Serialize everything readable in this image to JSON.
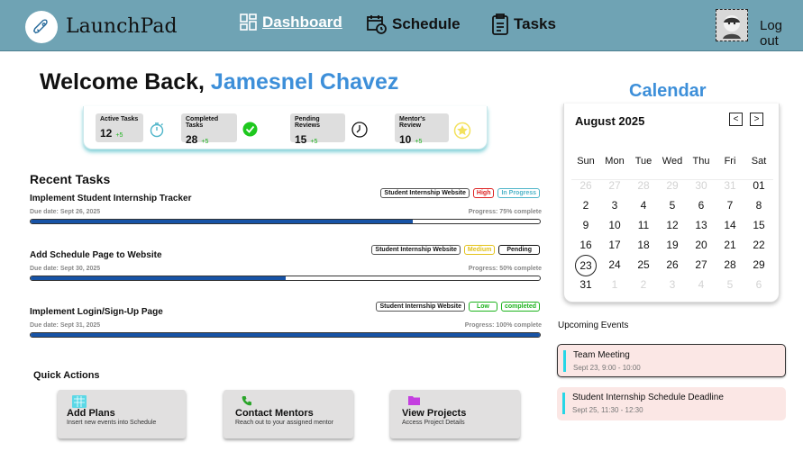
{
  "header": {
    "brand": "LaunchPad",
    "nav": [
      {
        "label": "Dashboard",
        "icon": "dashboard-grid-icon"
      },
      {
        "label": "Schedule",
        "icon": "calendar-clock-icon"
      },
      {
        "label": "Tasks",
        "icon": "clipboard-icon"
      }
    ],
    "logout": "Log out"
  },
  "welcome": {
    "greeting": "Welcome Back,",
    "name": "Jamesnel Chavez"
  },
  "stats": [
    {
      "title": "Active Tasks",
      "value": "12",
      "delta": "+5",
      "icon": "timer-icon"
    },
    {
      "title": "Completed Tasks",
      "value": "28",
      "delta": "+5",
      "icon": "check-circle-icon"
    },
    {
      "title": "Pending Reviews",
      "value": "15",
      "delta": "+5",
      "icon": "clock-icon"
    },
    {
      "title": "Mentor's Review",
      "value": "10",
      "delta": "+5",
      "icon": "star-badge-icon"
    }
  ],
  "recent_tasks": {
    "title": "Recent Tasks",
    "items": [
      {
        "title": "Implement  Student Internship Tracker",
        "due": "Due date: Sept 26, 2025",
        "progress_text": "Progress: 75% complete",
        "progress": 0.75,
        "project": "Student Internship Website",
        "priority": "High",
        "status": "In Progress"
      },
      {
        "title": "Add Schedule Page to Website",
        "due": "Due date: Sept 30, 2025",
        "progress_text": "Progress: 50% complete",
        "progress": 0.5,
        "project": "Student Internship Website",
        "priority": "Medium",
        "status": "Pending"
      },
      {
        "title": "Implement  Login/Sign-Up Page",
        "due": "Due date: Sept 31, 2025",
        "progress_text": "Progress: 100% complete",
        "progress": 1.0,
        "project": "Student Internship Website",
        "priority": "Low",
        "status": "completed"
      }
    ]
  },
  "quick_actions": {
    "title": "Quick Actions",
    "items": [
      {
        "title": "Add Plans",
        "desc": "Insert new events into Schedule",
        "icon": "planner-icon"
      },
      {
        "title": "Contact Mentors",
        "desc": "Reach out to your assigned mentor",
        "icon": "phone-icon"
      },
      {
        "title": "View Projects",
        "desc": "Access Project Details",
        "icon": "folder-icon"
      }
    ]
  },
  "calendar": {
    "title": "Calendar",
    "month": "August 2025",
    "prev": "<",
    "next": ">",
    "day_names": [
      "Sun",
      "Mon",
      "Tue",
      "Wed",
      "Thu",
      "Fri",
      "Sat"
    ],
    "days": [
      {
        "d": "26",
        "m": true
      },
      {
        "d": "27",
        "m": true
      },
      {
        "d": "28",
        "m": true
      },
      {
        "d": "29",
        "m": true
      },
      {
        "d": "30",
        "m": true
      },
      {
        "d": "31",
        "m": true
      },
      {
        "d": "01"
      },
      {
        "d": "2"
      },
      {
        "d": "3"
      },
      {
        "d": "4"
      },
      {
        "d": "5"
      },
      {
        "d": "6"
      },
      {
        "d": "7"
      },
      {
        "d": "8"
      },
      {
        "d": "9"
      },
      {
        "d": "10"
      },
      {
        "d": "11"
      },
      {
        "d": "12"
      },
      {
        "d": "13"
      },
      {
        "d": "14"
      },
      {
        "d": "15"
      },
      {
        "d": "16"
      },
      {
        "d": "17"
      },
      {
        "d": "18"
      },
      {
        "d": "19"
      },
      {
        "d": "20"
      },
      {
        "d": "21"
      },
      {
        "d": "22"
      },
      {
        "d": "23",
        "today": true
      },
      {
        "d": "24"
      },
      {
        "d": "25"
      },
      {
        "d": "26"
      },
      {
        "d": "27"
      },
      {
        "d": "28"
      },
      {
        "d": "29"
      },
      {
        "d": "31"
      },
      {
        "d": "1",
        "m": true
      },
      {
        "d": "2",
        "m": true
      },
      {
        "d": "3",
        "m": true
      },
      {
        "d": "4",
        "m": true
      },
      {
        "d": "5",
        "m": true
      },
      {
        "d": "6",
        "m": true
      }
    ]
  },
  "events": {
    "title": "Upcoming Events",
    "items": [
      {
        "title": "Team Meeting",
        "time": "Sept 23, 9:00 - 10:00"
      },
      {
        "title": "Student Internship Schedule Deadline",
        "time": "Sept 25, 11:30 - 12:30"
      }
    ]
  },
  "colors": {
    "header": "#6fa3b4",
    "accent": "#3d8fd9",
    "progress": "#1753a6"
  }
}
